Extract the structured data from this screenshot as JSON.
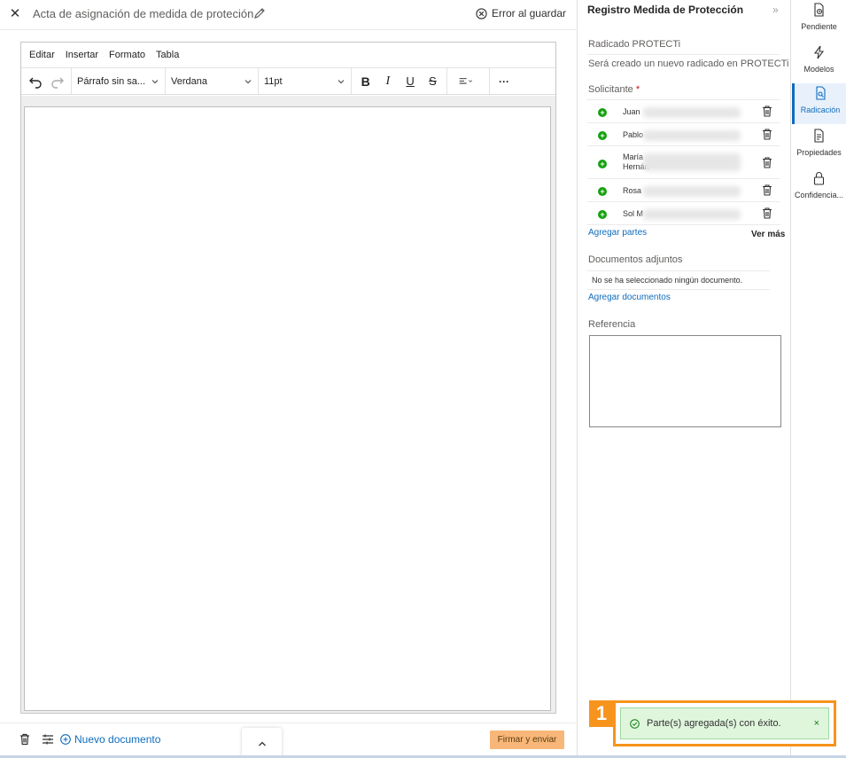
{
  "document": {
    "title": "Acta de asignación de medida de proteción",
    "save_status": "Error al guardar"
  },
  "editor": {
    "menu": [
      "Editar",
      "Insertar",
      "Formato",
      "Tabla"
    ],
    "paragraph_style": "Párrafo sin sa...",
    "font_family": "Verdana",
    "font_size": "11pt",
    "bold_label": "B",
    "italic_label": "I",
    "underline_label": "U",
    "strike_label": "S",
    "more_label": "···"
  },
  "bottom_bar": {
    "new_document": "Nuevo documento",
    "sign_send": "Firmar y enviar"
  },
  "panel": {
    "title": "Registro Medida de Protección",
    "expand": "»",
    "radicado_label": "Radicado PROTECTi",
    "radicado_value": "Será creado un nuevo radicado en PROTECTi",
    "solicitante_label": "Solicitante",
    "required_mark": "*",
    "parties": [
      {
        "name": "Juan "
      },
      {
        "name": "Pablo"
      },
      {
        "name": "María Hernán"
      },
      {
        "name": "Rosa"
      },
      {
        "name": "Sol M"
      }
    ],
    "add_parties": "Agregar partes",
    "see_more": "Ver más",
    "attachments_label": "Documentos adjuntos",
    "no_document": "No se ha seleccionado ningún documento.",
    "add_documents": "Agregar documentos",
    "reference_label": "Referencia"
  },
  "rail": {
    "items": [
      {
        "label": "Pendiente",
        "icon": "pending-doc-icon"
      },
      {
        "label": "Modelos",
        "icon": "lightning-icon"
      },
      {
        "label": "Radicación",
        "icon": "filing-doc-icon",
        "active": true
      },
      {
        "label": "Propiedades",
        "icon": "properties-doc-icon"
      },
      {
        "label": "Confidencia...",
        "icon": "lock-icon"
      }
    ]
  },
  "toast": {
    "step": "1",
    "message": "Parte(s) agregada(s) con éxito.",
    "close": "×"
  },
  "colors": {
    "accent": "#0f6cbd",
    "sign_button": "#f8b778",
    "toast_bg": "#dff6dd",
    "highlight": "#f7941d",
    "add_icon": "#13a10e"
  }
}
